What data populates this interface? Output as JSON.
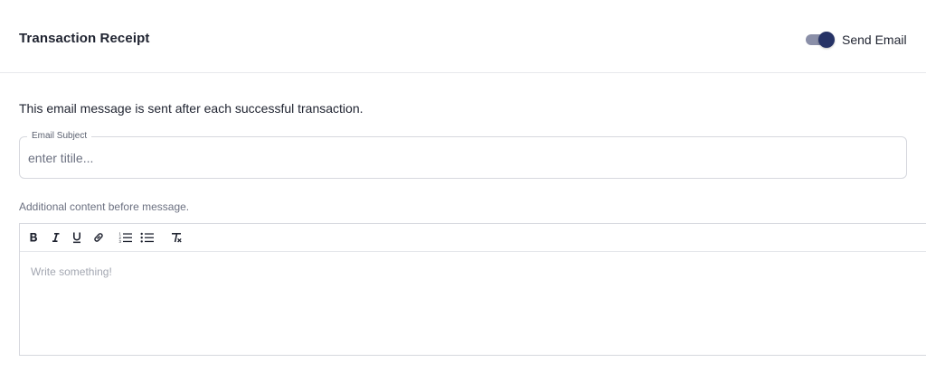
{
  "header": {
    "title": "Transaction Receipt",
    "toggle_label": "Send Email",
    "toggle_on": true
  },
  "description": "This email message is sent after each successful transaction.",
  "subject": {
    "label": "Email Subject",
    "placeholder": "enter titile...",
    "value": ""
  },
  "additional_label": "Additional content before message.",
  "editor": {
    "toolbar": [
      {
        "name": "bold-icon"
      },
      {
        "name": "italic-icon"
      },
      {
        "name": "underline-icon"
      },
      {
        "name": "link-icon"
      },
      {
        "name": "ordered-list-icon"
      },
      {
        "name": "bullet-list-icon"
      },
      {
        "name": "clear-format-icon"
      }
    ],
    "placeholder": "Write something!"
  },
  "colors": {
    "toggle_knob": "#263366",
    "toggle_track": "#8a8fa8",
    "text": "#1f2330",
    "border": "#d6d8de"
  }
}
